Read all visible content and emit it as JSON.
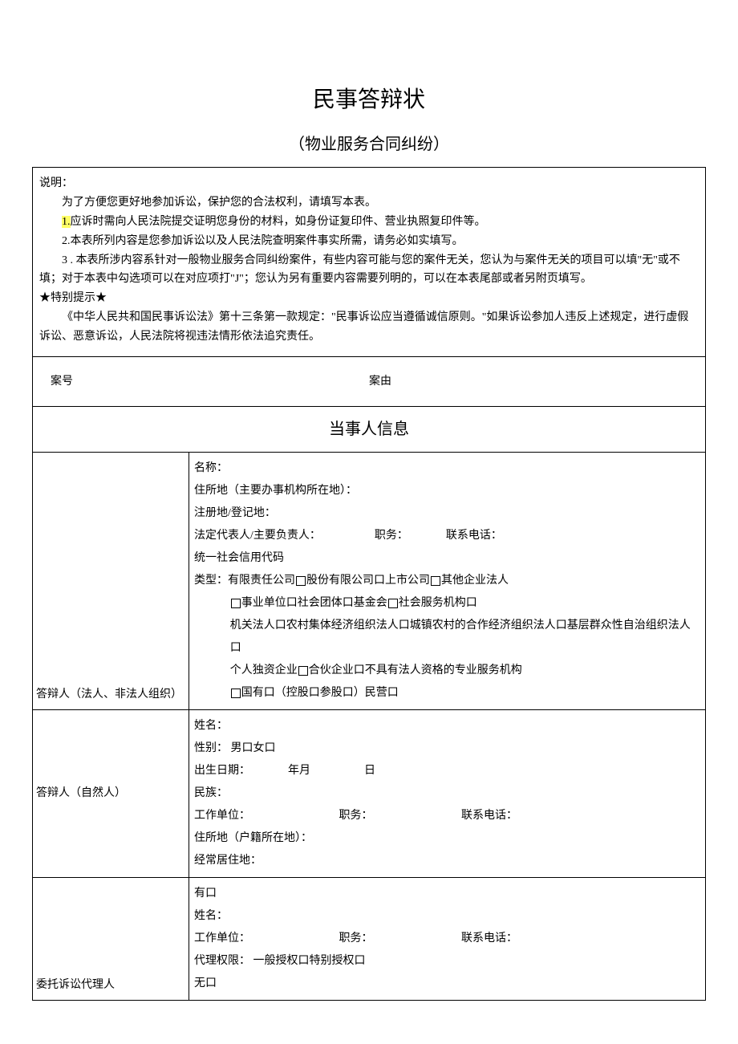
{
  "title": "民事答辩状",
  "subtitle": "（物业服务合同纠纷）",
  "instructions": {
    "heading": "说明：",
    "line1": "为了方便您更好地参加诉讼，保护您的合法权利，请填写本表。",
    "line2_num": "1.",
    "line2": "应诉时需向人民法院提交证明您身份的材料，如身份证复印件、营业执照复印件等。",
    "line3": "2.本表所列内容是您参加诉讼以及人民法院查明案件事实所需，请务必如实填写。",
    "line4": "3 . 本表所涉内容系针对一般物业服务合同纠纷案件，有些内容可能与您的案件无关，您认为与案件无关的项目可以填\"无\"或不填；对于本表中勾选项可以在对应项打\"J\"；您认为另有重要内容需要列明的，可以在本表尾部或者另附页填写。",
    "tip_header": "★特别提示★",
    "tip_body": "《中华人民共和国民事诉讼法》第十三条第一款规定：\"民事诉讼应当遵循诚信原则。\"如果诉讼参加人违反上述规定，进行虚假诉讼、恶意诉讼，人民法院将视违法情形依法追究责任。"
  },
  "case": {
    "number_label": "案号",
    "cause_label": "案由"
  },
  "section_party_header": "当事人信息",
  "respondent_org": {
    "label": "答辩人（法人、非法人组织）",
    "name": "名称：",
    "residence": "住所地（主要办事机构所在地）：",
    "registered": "注册地/登记地：",
    "legal_rep": "法定代表人/主要负责人：",
    "position": "职务：",
    "phone": "联系电话：",
    "credit_code": "统一社会信用代码",
    "type_label": "类型：",
    "type1": "有限责任公司",
    "type2": "股份有限公司口",
    "type3": "上市公司",
    "type4": "其他企业法人",
    "type5": "事业单位口",
    "type6": "社会团体口",
    "type7": "基金会",
    "type8": "社会服务机构口",
    "type9": "机关法人口",
    "type10": "农村集体经济组织法人口",
    "type11": "城镇农村的合作经济组织法人口",
    "type12": "基层群众性自治组织法人口",
    "type13": "个人独资企业",
    "type14": "合伙企业口",
    "type15": "不具有法人资格的专业服务机构",
    "type16": "国有口（控股口参股口）",
    "type17": "民营口"
  },
  "respondent_person": {
    "label": "答辩人（自然人）",
    "name": "姓名：",
    "gender": "性别：",
    "male": "男口",
    "female": "女口",
    "dob": "出生日期：",
    "year": "年",
    "month": "月",
    "day": "日",
    "ethnicity": "民族：",
    "workplace": "工作单位：",
    "position": "职务：",
    "phone": "联系电话：",
    "residence": "住所地（户籍所在地）：",
    "habitual": "经常居住地："
  },
  "agent": {
    "label": "委托诉讼代理人",
    "has": "有口",
    "name": "姓名：",
    "workplace": "工作单位：",
    "position": "职务：",
    "phone": "联系电话：",
    "auth": "代理权限：",
    "auth_general": "一般授权口",
    "auth_special": "特别授权口",
    "none": "无口"
  }
}
